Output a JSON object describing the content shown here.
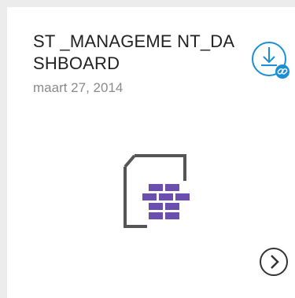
{
  "card": {
    "title": "ST        _MANAGEME NT_DASHBOARD",
    "date": "maart 27, 2014"
  },
  "icons": {
    "download": "download-link-icon",
    "file_type": "database-report-file-icon",
    "next": "chevron-right-circle-icon"
  },
  "colors": {
    "accent": "#1a8fd6",
    "file_purple": "#6a4fae",
    "file_outline": "#555555"
  }
}
